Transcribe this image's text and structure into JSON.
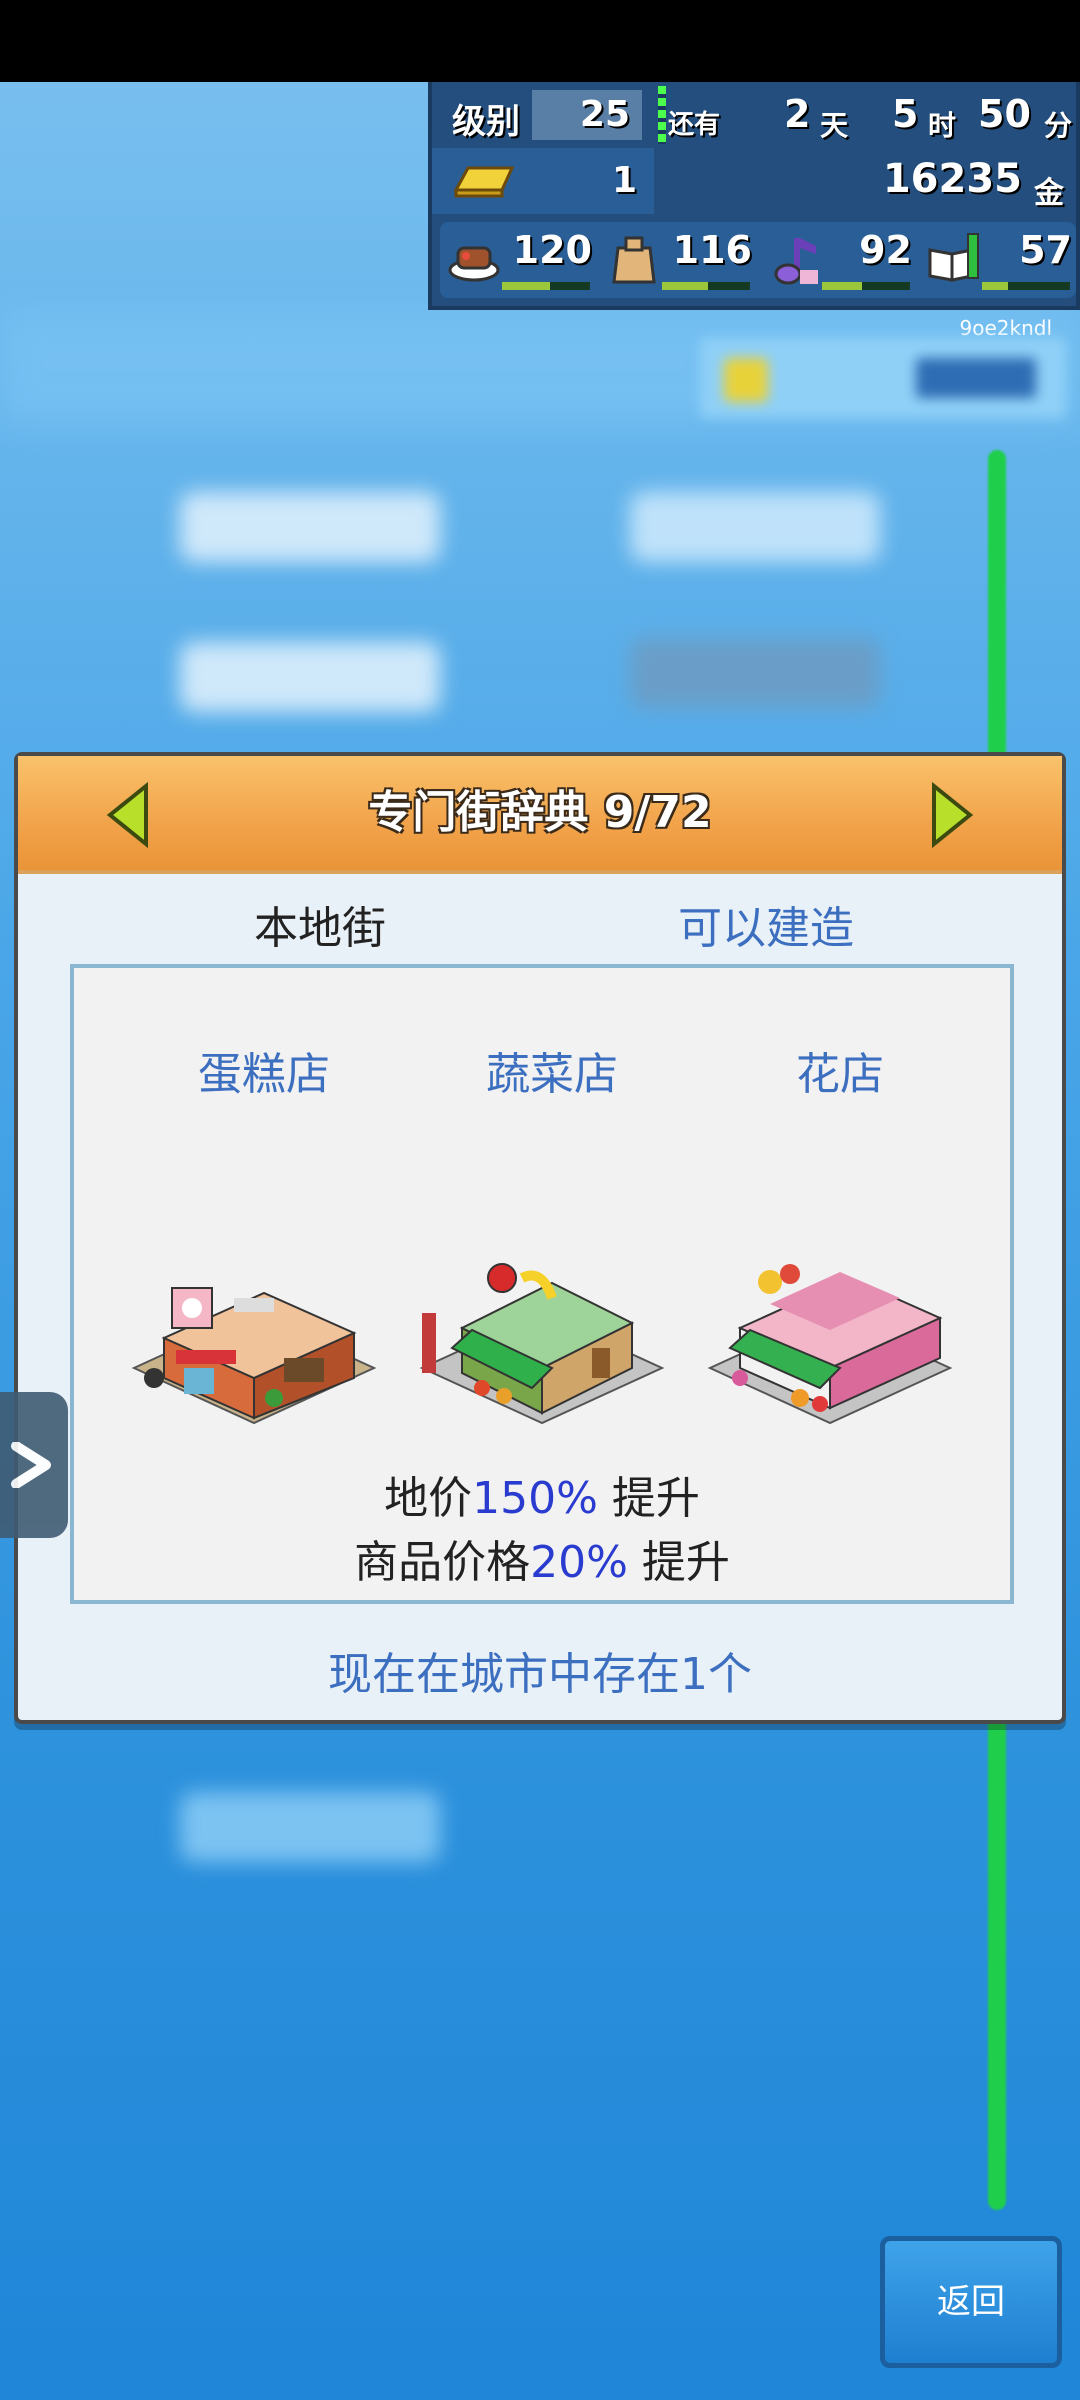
{
  "status_panel": {
    "level_label": "级别",
    "level_value": "25",
    "time_prefix": "还有",
    "days": "2",
    "days_unit": "天",
    "hours": "5",
    "hours_unit": "时",
    "minutes": "50",
    "minutes_unit": "分",
    "gold_bars": "1",
    "money": "16235",
    "money_unit": "金",
    "resources": [
      {
        "icon": "food-icon",
        "value": "120",
        "level": 0.55
      },
      {
        "icon": "goods-bag-icon",
        "value": "116",
        "level": 0.52
      },
      {
        "icon": "music-note-icon",
        "value": "92",
        "level": 0.45
      },
      {
        "icon": "book-icon",
        "value": "57",
        "level": 0.3
      }
    ]
  },
  "corner_code": "9oe2kndl",
  "dialog": {
    "title": "专门街辞典 9/72",
    "category_left": "本地街",
    "category_right": "可以建造",
    "shops": [
      {
        "name": "蛋糕店",
        "icon": "cake-shop-icon"
      },
      {
        "name": "蔬菜店",
        "icon": "vegetable-shop-icon"
      },
      {
        "name": "花店",
        "icon": "flower-shop-icon"
      }
    ],
    "land_label": "地价",
    "land_value": "150%",
    "land_suffix": " 提升",
    "goods_label": "商品价格",
    "goods_value": "20%",
    "goods_suffix": " 提升",
    "existing": "现在在城市中存在1个"
  },
  "back_button": "返回",
  "colors": {
    "accent_blue": "#3d6fc0",
    "highlight": "#2a3ccf",
    "header_orange": "#f2a34a"
  }
}
